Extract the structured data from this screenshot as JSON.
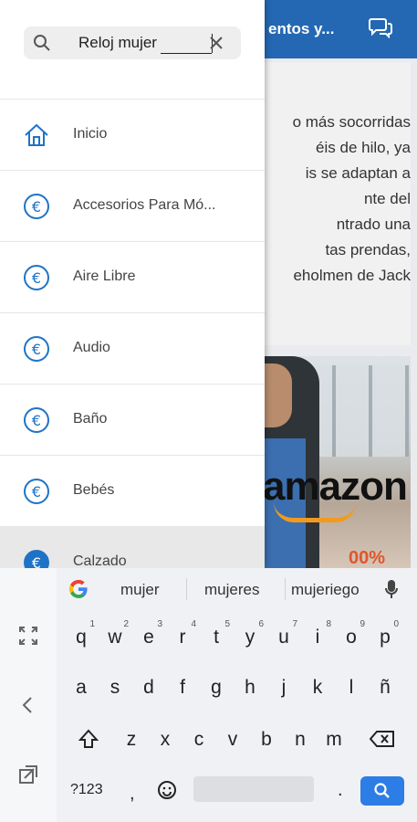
{
  "app": {
    "header_title_partial": "entos y...",
    "article_lines": [
      "o más socorridas",
      "éis de hilo, ya",
      "is se adaptan a",
      "nte del",
      "ntrado una",
      "tas prendas,",
      "eholmen de Jack"
    ],
    "promo": {
      "logo_text": "amazon",
      "badge": "00%"
    }
  },
  "drawer": {
    "search": {
      "value": "Reloj mujer",
      "placeholder": ""
    },
    "items": [
      {
        "label": "Inicio",
        "icon": "home-icon"
      },
      {
        "label": "Accesorios Para Mó...",
        "icon": "euro-icon"
      },
      {
        "label": "Aire Libre",
        "icon": "euro-icon"
      },
      {
        "label": "Audio",
        "icon": "euro-icon"
      },
      {
        "label": "Baño",
        "icon": "euro-icon"
      },
      {
        "label": "Bebés",
        "icon": "euro-icon"
      },
      {
        "label": "Calzado",
        "icon": "euro-icon",
        "active": true
      }
    ]
  },
  "keyboard": {
    "suggestions": [
      "mujer",
      "mujeres",
      "mujeriego"
    ],
    "row1": [
      "q",
      "w",
      "e",
      "r",
      "t",
      "y",
      "u",
      "i",
      "o",
      "p"
    ],
    "row1_hints": [
      "1",
      "2",
      "3",
      "4",
      "5",
      "6",
      "7",
      "8",
      "9",
      "0"
    ],
    "row2": [
      "a",
      "s",
      "d",
      "f",
      "g",
      "h",
      "j",
      "k",
      "l",
      "ñ"
    ],
    "row3": [
      "z",
      "x",
      "c",
      "v",
      "b",
      "n",
      "m"
    ],
    "bottom": {
      "symbols": "?123",
      "comma": ",",
      "period": "."
    }
  },
  "colors": {
    "brand": "#2468b3",
    "accent": "#2c7de5",
    "icon_blue": "#1f73c6"
  }
}
